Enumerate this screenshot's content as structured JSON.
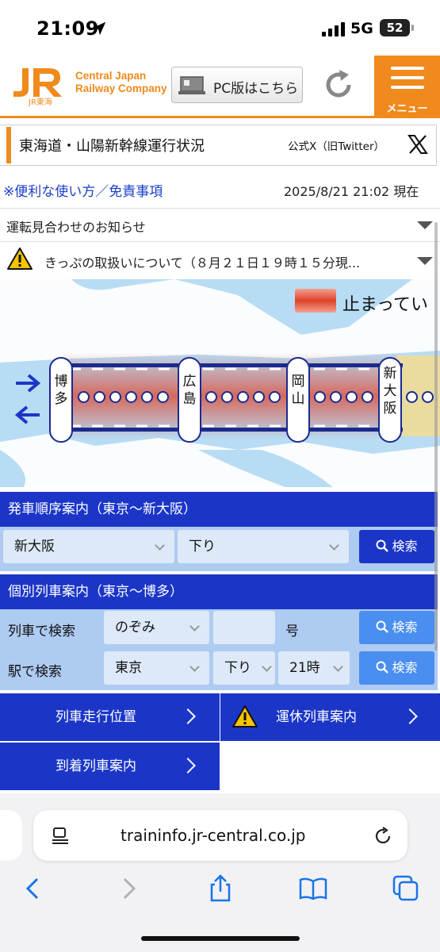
{
  "status_bar": {
    "time": "21:09",
    "network": "5G",
    "battery": "52"
  },
  "header": {
    "logo_text": "JR東海",
    "company_line1": "Central Japan",
    "company_line2": "Railway Company",
    "pc_button_label": "PC版はこちら",
    "menu_label": "メニュー",
    "accent_color": "#f08a1c"
  },
  "title_bar": {
    "title": "東海道・山陽新幹線運行状況",
    "official_x": "公式X（旧Twitter）"
  },
  "info": {
    "help_link": "※便利な使い方／免責事項",
    "updated_at": "2025/8/21 21:02 現在",
    "notice_1": "運転見合わせのお知らせ",
    "notice_2": "きっぷの取扱いについて（８月２１日１９時１５分現..."
  },
  "map": {
    "legend_label": "止まってい",
    "stations": [
      {
        "line1": "博",
        "line2": "多",
        "line3": ""
      },
      {
        "line1": "広",
        "line2": "島",
        "line3": ""
      },
      {
        "line1": "岡",
        "line2": "山",
        "line3": ""
      },
      {
        "line1": "新",
        "line2": "大",
        "line3": "阪"
      }
    ],
    "stopped_color": "#e0432c",
    "line_color": "#1b2a8f"
  },
  "departure_panel": {
    "heading": "発車順序案内（東京〜新大阪）",
    "station_value": "新大阪",
    "direction_value": "下り",
    "search_label": "検索"
  },
  "train_panel": {
    "heading": "個別列車案内（東京〜博多）",
    "by_train_label": "列車で検索",
    "train_name_value": "のぞみ",
    "train_number_value": "",
    "number_suffix": "号",
    "by_station_label": "駅で検索",
    "station_value": "東京",
    "direction_value": "下り",
    "hour_value": "21時",
    "search_label": "検索"
  },
  "bottom_nav": {
    "train_position": "列車走行位置",
    "cancelled_trains": "運休列車案内",
    "arrival_info": "到着列車案内"
  },
  "safari": {
    "url": "traininfo.jr-central.co.jp"
  }
}
